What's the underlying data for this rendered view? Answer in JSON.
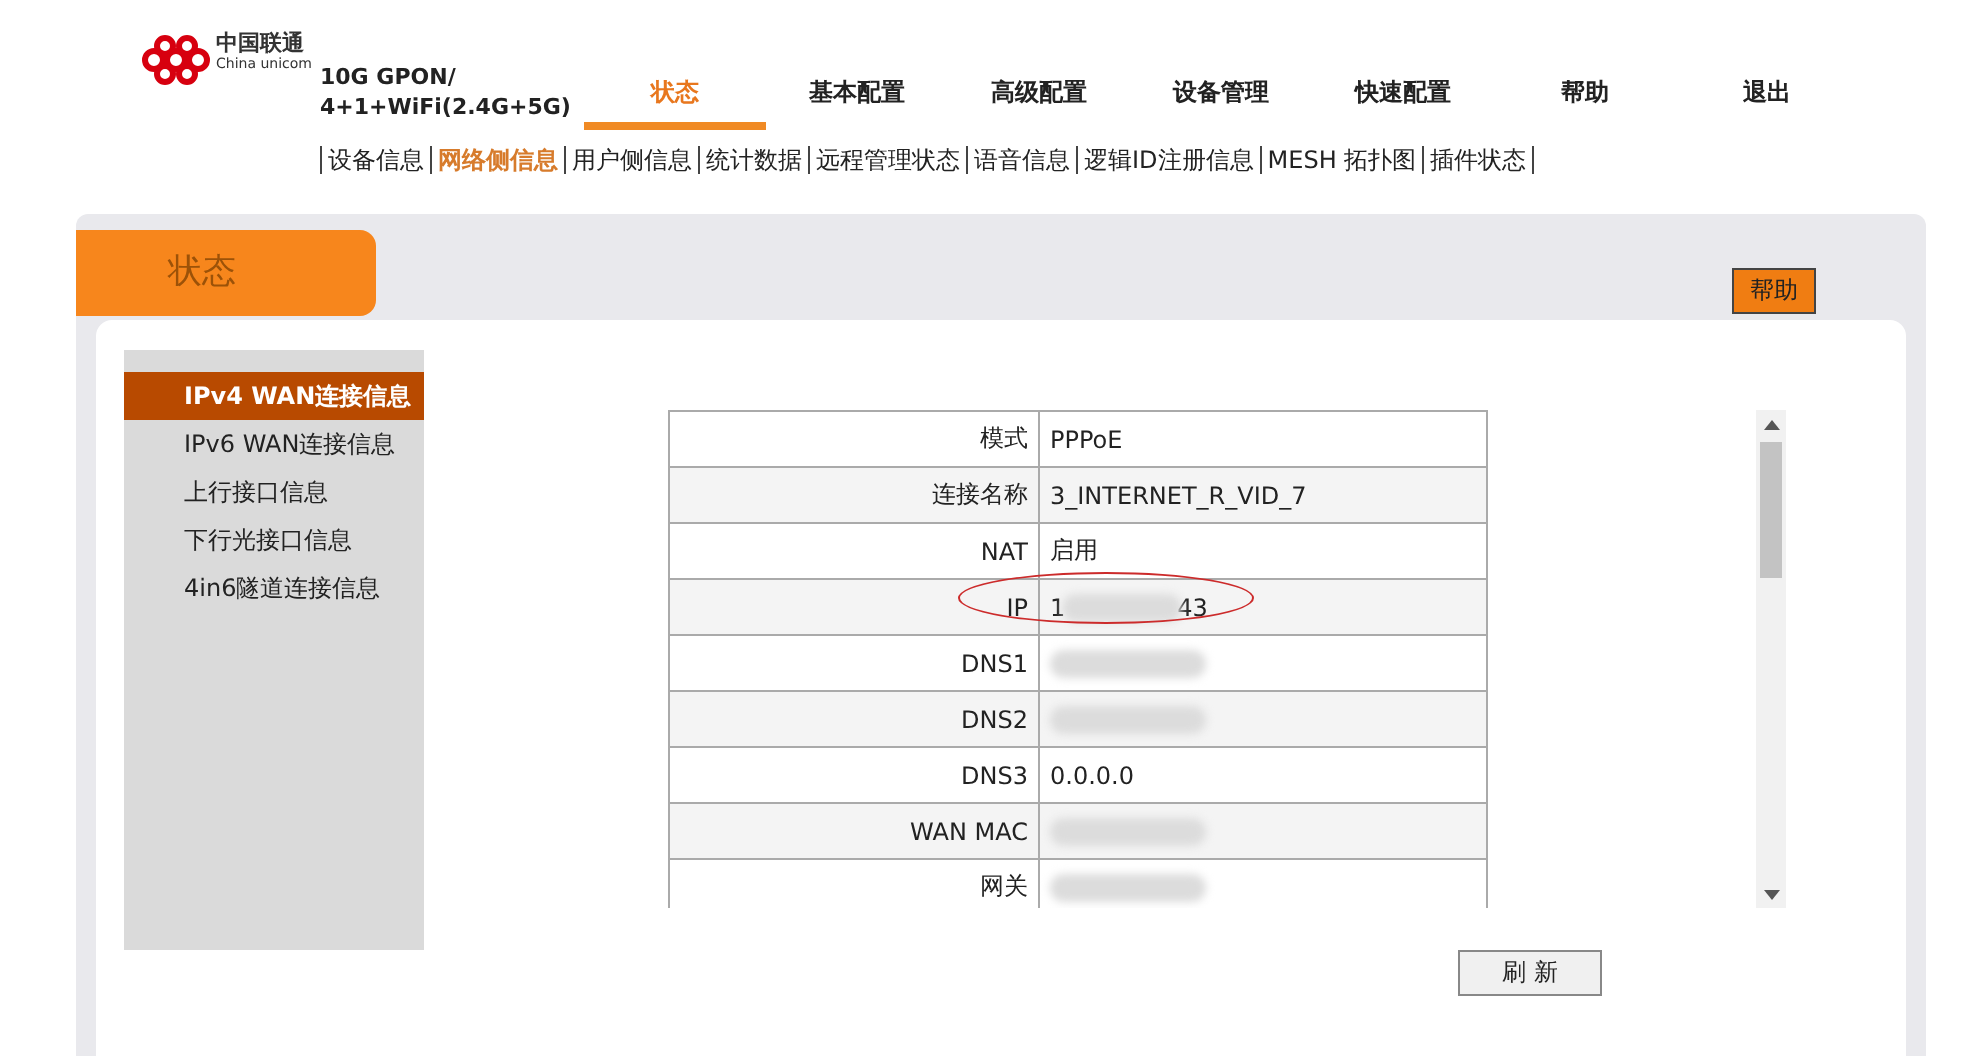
{
  "logo": {
    "name": "中国联通",
    "subname": "China unicom"
  },
  "product": {
    "line1": "10G GPON/",
    "line2": "4+1+WiFi(2.4G+5G)"
  },
  "main_menu": [
    {
      "label": "状态",
      "selected": true
    },
    {
      "label": "基本配置",
      "selected": false
    },
    {
      "label": "高级配置",
      "selected": false
    },
    {
      "label": "设备管理",
      "selected": false
    },
    {
      "label": "快速配置",
      "selected": false
    },
    {
      "label": "帮助",
      "selected": false
    },
    {
      "label": "退出",
      "selected": false
    }
  ],
  "sub_menu": [
    {
      "label": "设备信息",
      "selected": false
    },
    {
      "label": "网络侧信息",
      "selected": true
    },
    {
      "label": "用户侧信息",
      "selected": false
    },
    {
      "label": "统计数据",
      "selected": false
    },
    {
      "label": "远程管理状态",
      "selected": false
    },
    {
      "label": "语音信息",
      "selected": false
    },
    {
      "label": "逻辑ID注册信息",
      "selected": false
    },
    {
      "label": "MESH 拓扑图",
      "selected": false
    },
    {
      "label": "插件状态",
      "selected": false
    }
  ],
  "section_title": "状态",
  "help_button": "帮助",
  "sidebar": {
    "items": [
      {
        "label": "IPv4 WAN连接信息",
        "selected": true
      },
      {
        "label": "IPv6 WAN连接信息",
        "selected": false
      },
      {
        "label": "上行接口信息",
        "selected": false
      },
      {
        "label": "下行光接口信息",
        "selected": false
      },
      {
        "label": "4in6隧道连接信息",
        "selected": false
      }
    ]
  },
  "table": {
    "rows": [
      {
        "label": "模式",
        "value": "PPPoE",
        "redacted": false,
        "circled": false
      },
      {
        "label": "连接名称",
        "value": "3_INTERNET_R_VID_7",
        "redacted": false,
        "circled": false
      },
      {
        "label": "NAT",
        "value": "启用",
        "redacted": false,
        "circled": false
      },
      {
        "label": "IP",
        "value": "1",
        "value_end": "43",
        "redacted": true,
        "circled": true
      },
      {
        "label": "DNS1",
        "redacted": true,
        "circled": false
      },
      {
        "label": "DNS2",
        "redacted": true,
        "circled": false
      },
      {
        "label": "DNS3",
        "value": "0.0.0.0",
        "redacted": false,
        "circled": false
      },
      {
        "label": "WAN MAC",
        "redacted": true,
        "circled": false
      },
      {
        "label": "网关",
        "redacted": true,
        "circled": false
      }
    ]
  },
  "refresh_button": "刷 新"
}
